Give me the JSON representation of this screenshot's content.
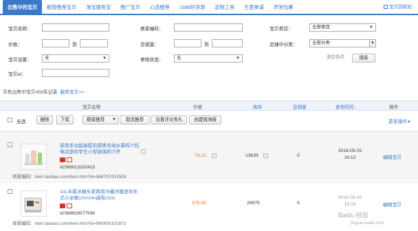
{
  "tabs": [
    {
      "label": "出售中的宝贝"
    },
    {
      "label": "橱窗推荐宝贝"
    },
    {
      "label": "淘宝服务宝"
    },
    {
      "label": "推广宝贝"
    },
    {
      "label": "心选推荐"
    },
    {
      "label": "1688好货源"
    },
    {
      "label": "定制工具"
    },
    {
      "label": "生意参谋"
    },
    {
      "label": "异常包裹"
    }
  ],
  "top_right_link": "宝贝回收站",
  "filters": {
    "name_label": "宝贝名称：",
    "code_label": "商家编码：",
    "category_label": "宝贝类目：",
    "category_value": "全部类目",
    "price_label": "价格：",
    "to_label": "到",
    "sales_label": "总销量：",
    "sales_to_label": "到",
    "shop_cat_label": "店铺中分类：",
    "shop_cat_value": "全部分类",
    "settings_label": "宝贝设置：",
    "settings_value": "无",
    "audit_label": "审核状态：",
    "audit_value": "无",
    "id_label": "宝贝id：",
    "clear_label": "清空条件",
    "search_label": "搜索"
  },
  "summary": {
    "text": "共有出售中宝贝459条记录",
    "link": "服务宝贝>>"
  },
  "table_headers": {
    "name": "宝贝名称",
    "price": "价格",
    "stock": "库存",
    "sales": "总销量",
    "time": "发布时间",
    "ops": "操作"
  },
  "toolbar": {
    "select_all": "全选",
    "delete": "删除",
    "delist": "下架",
    "recommend": "橱窗推荐",
    "cancel_recommend": "取消推荐",
    "set_review": "设置评论有礼",
    "create_campaign": "创建微海报",
    "more": "更多操作"
  },
  "rows": [
    {
      "title": "家用多功能破壁机便携充电水果榨汁机电动迷你学生小型玻璃榨汁杯",
      "id": "id:569013202413",
      "merchant": "商家编码：item.taobao.com/item.htm?id=566797001509",
      "price": "74.22",
      "stock": "13635",
      "sales": "0",
      "date": "2018-05-02",
      "time": "16:12",
      "edit": "编辑宝贝"
    },
    {
      "title": "10L车载冰箱车家两用冷藏冷暖迷你车式小冰箱12V/24v通用220v",
      "id": "id:568919077536",
      "merchant": "商家编码：item.taobao.com/item.htm?id=560605101872",
      "price": "375.50",
      "stock": "29975",
      "sales": "0",
      "date": "2018-05-02",
      "time": "15:33",
      "edit": "编辑宝贝"
    }
  ],
  "watermark": "Baidu 经验",
  "watermark_url": "jingyan.baidu.com",
  "colors": {
    "accent": "#3a78c9",
    "price": "#e86c1e",
    "tag": "#d9302c"
  }
}
